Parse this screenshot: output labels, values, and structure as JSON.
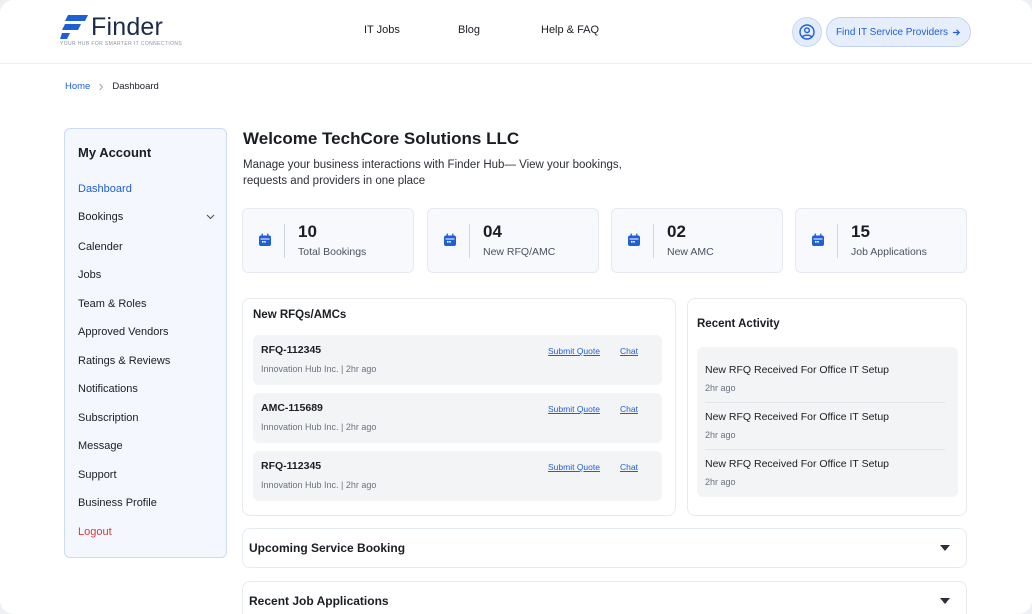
{
  "header": {
    "logo_text": "Finder",
    "logo_tagline": "YOUR HUB FOR SMARTER IT CONNECTIONS",
    "nav": [
      {
        "label": "IT Jobs"
      },
      {
        "label": "Blog"
      },
      {
        "label": "Help & FAQ"
      }
    ],
    "cta_label": "Find IT Service Providers",
    "cta_icon": "arrow-right-icon",
    "avatar_icon": "user-circle-icon"
  },
  "breadcrumb": {
    "home": "Home",
    "current": "Dashboard"
  },
  "sidebar": {
    "title": "My Account",
    "items": [
      {
        "label": "Dashboard",
        "state": "active"
      },
      {
        "label": "Bookings",
        "has_chevron": true
      },
      {
        "label": "Calender"
      },
      {
        "label": "Jobs"
      },
      {
        "label": "Team & Roles"
      },
      {
        "label": "Approved Vendors"
      },
      {
        "label": "Ratings & Reviews"
      },
      {
        "label": "Notifications"
      },
      {
        "label": "Subscription"
      },
      {
        "label": "Message"
      },
      {
        "label": "Support"
      },
      {
        "label": "Business Profile"
      },
      {
        "label": "Logout",
        "state": "danger"
      }
    ]
  },
  "welcome": {
    "title": "Welcome TechCore Solutions LLC",
    "subtitle_line1": "Manage your business interactions with Finder Hub— View your bookings,",
    "subtitle_line2": "requests and providers in one place"
  },
  "stats": [
    {
      "value": "10",
      "label": "Total Bookings",
      "icon": "calendar-icon"
    },
    {
      "value": "04",
      "label": "New RFQ/AMC",
      "icon": "calendar-icon"
    },
    {
      "value": "02",
      "label": "New AMC",
      "icon": "calendar-icon"
    },
    {
      "value": "15",
      "label": "Job Applications",
      "icon": "calendar-icon"
    }
  ],
  "rfqs": {
    "title": "New RFQs/AMCs",
    "items": [
      {
        "id": "RFQ-112345",
        "meta": "Innovation Hub Inc. | 2hr ago",
        "quote": "Submit Quote",
        "chat": "Chat"
      },
      {
        "id": "AMC-115689",
        "meta": "Innovation Hub Inc. | 2hr ago",
        "quote": "Submit Quote",
        "chat": "Chat"
      },
      {
        "id": "RFQ-112345",
        "meta": "Innovation Hub Inc. | 2hr ago",
        "quote": "Submit Quote",
        "chat": "Chat"
      }
    ]
  },
  "activity": {
    "title": "Recent Activity",
    "items": [
      {
        "text": "New RFQ Received For Office IT Setup",
        "time": "2hr ago"
      },
      {
        "text": "New RFQ Received For Office IT Setup",
        "time": "2hr ago"
      },
      {
        "text": "New RFQ Received For Office IT Setup",
        "time": "2hr ago"
      }
    ]
  },
  "sections": [
    {
      "label": "Upcoming Service Booking"
    },
    {
      "label": "Recent Job Applications"
    }
  ],
  "colors": {
    "accent": "#1f5fd6",
    "danger": "#d63a3a",
    "text": "#1a1d23",
    "sidebar_bg": "#f4f7fd"
  }
}
